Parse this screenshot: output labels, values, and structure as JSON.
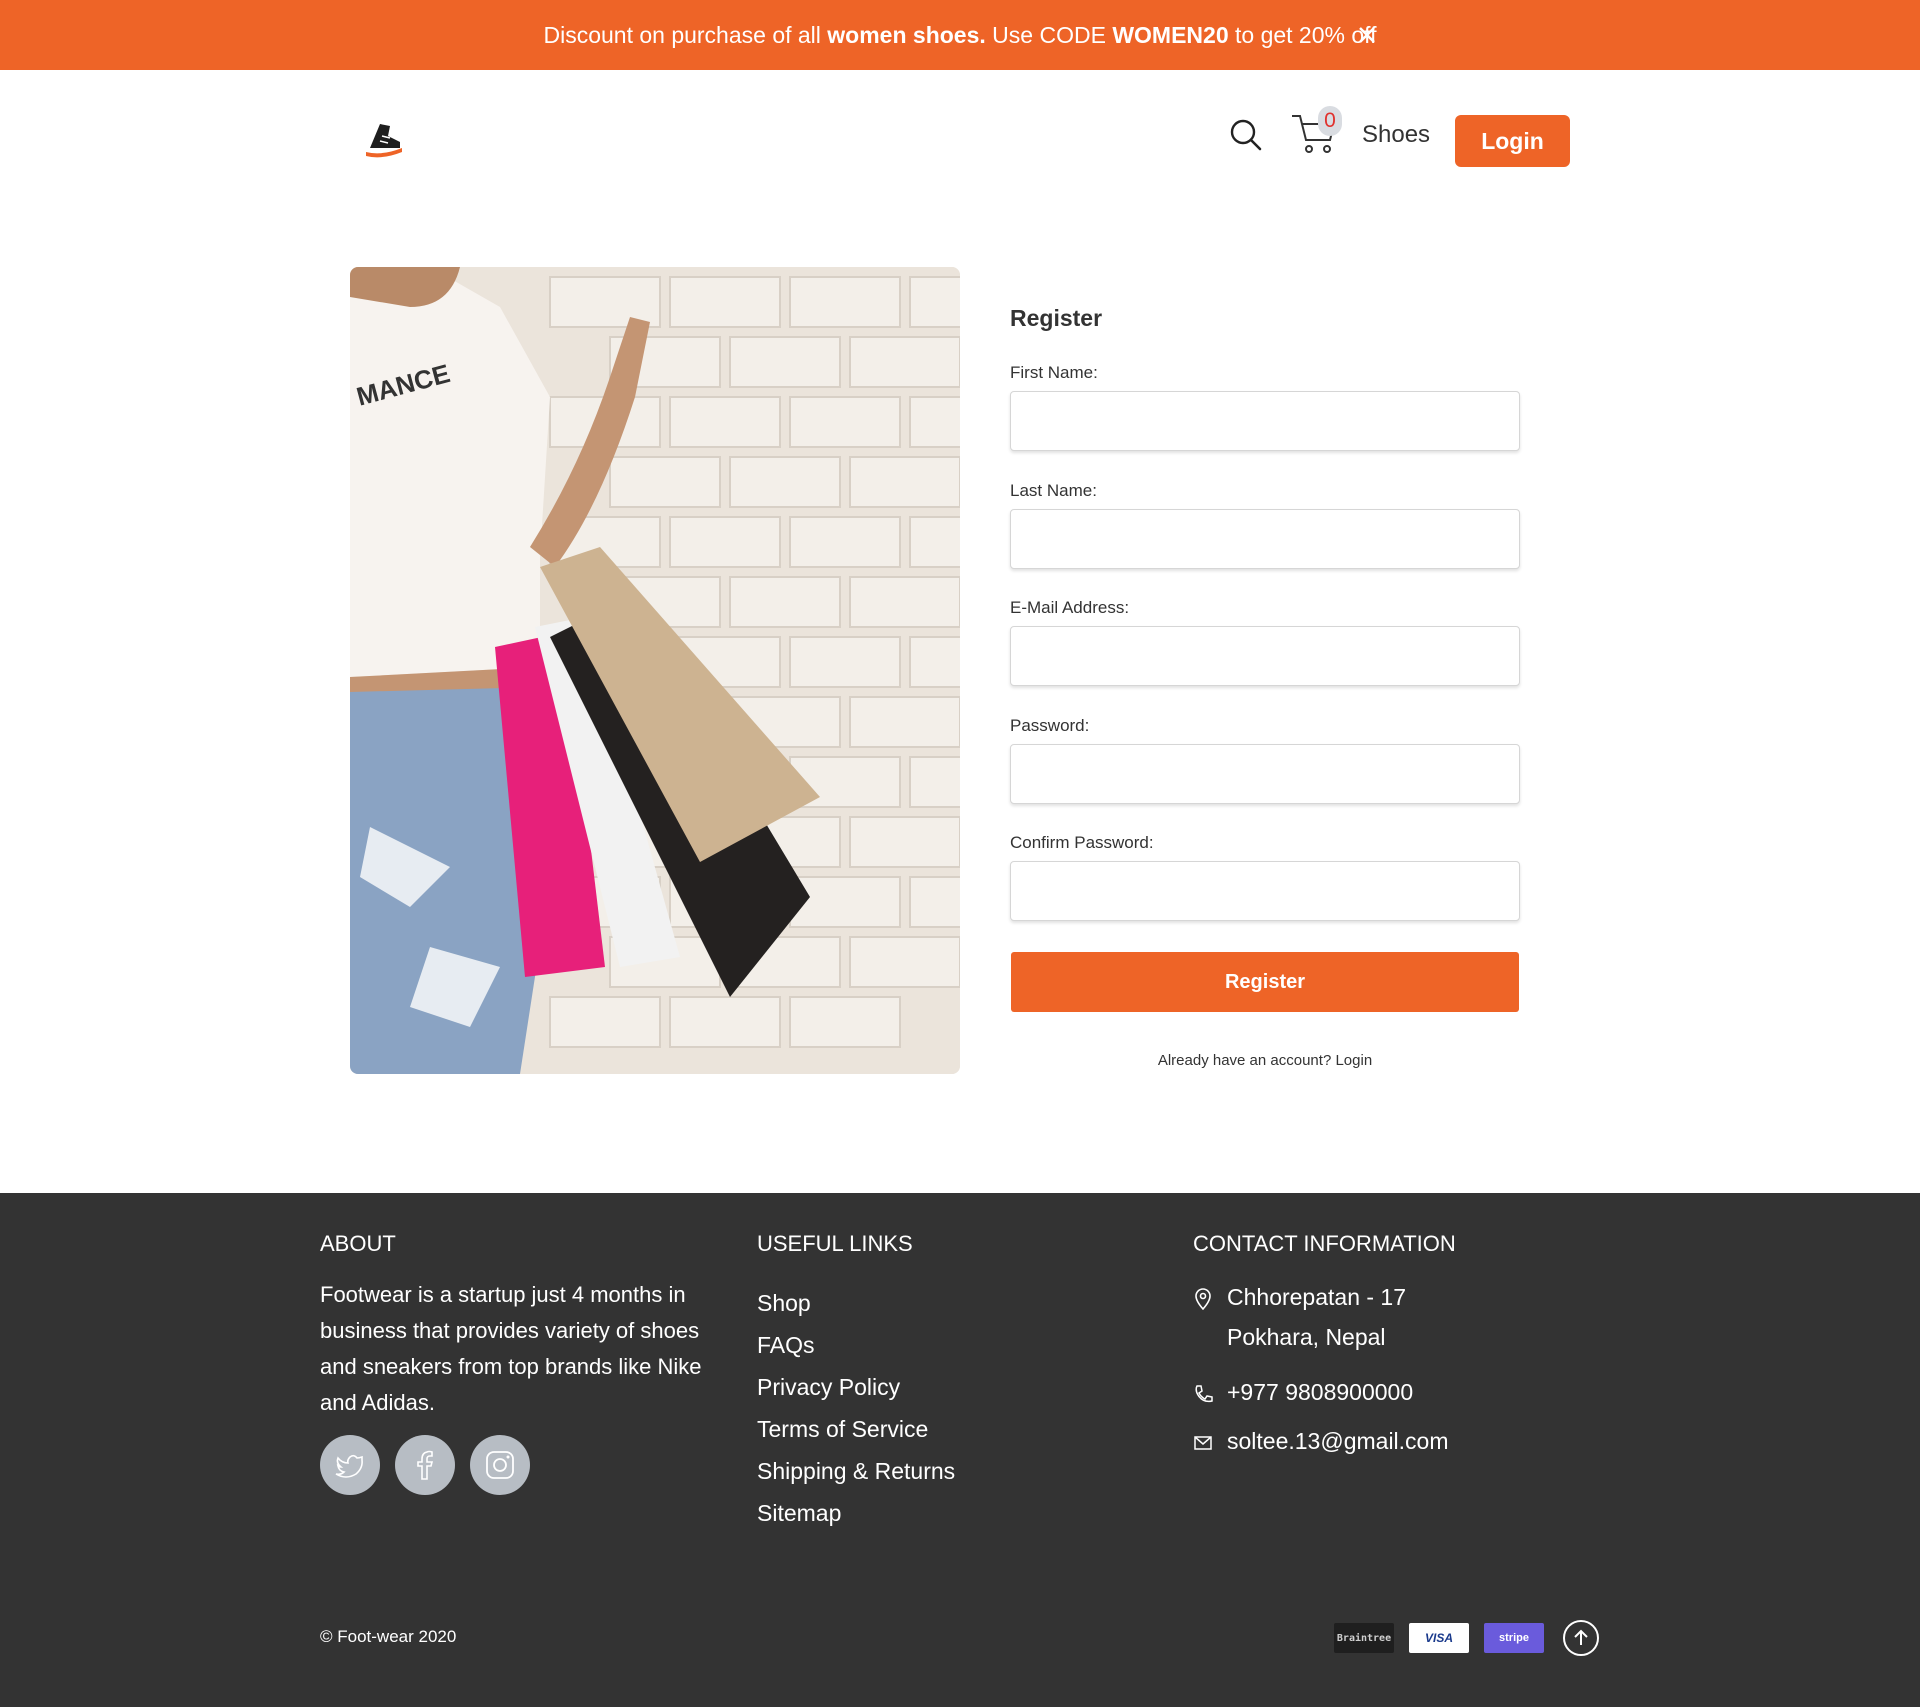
{
  "promo": {
    "text_1": "Discount on purchase of all ",
    "bold_1": "women shoes.",
    "text_2": " Use CODE ",
    "bold_2": "WOMEN20",
    "text_3": " to get 20% off",
    "close_icon": "close-icon"
  },
  "header": {
    "logo_icon": "sneaker-logo-icon",
    "search_icon": "search-icon",
    "cart_icon": "cart-icon",
    "cart_count": "0",
    "nav_shoes": "Shoes",
    "login_label": "Login"
  },
  "form": {
    "title": "Register",
    "fields": [
      {
        "label": "First Name:",
        "value": ""
      },
      {
        "label": "Last Name:",
        "value": ""
      },
      {
        "label": "E-Mail Address:",
        "value": ""
      },
      {
        "label": "Password:",
        "value": ""
      },
      {
        "label": "Confirm Password:",
        "value": ""
      }
    ],
    "submit_label": "Register",
    "have_account": "Already have an account?",
    "login_link": "Login"
  },
  "footer": {
    "about_heading": "ABOUT",
    "about_text": "Footwear is a startup just 4 months in business that provides variety of shoes and sneakers from top brands like Nike and Adidas.",
    "social": [
      "twitter-icon",
      "facebook-icon",
      "instagram-icon"
    ],
    "links_heading": "USEFUL LINKS",
    "links": [
      "Shop",
      "FAQs",
      "Privacy Policy",
      "Terms of Service",
      "Shipping & Returns",
      "Sitemap"
    ],
    "contact_heading": "CONTACT INFORMATION",
    "address_line1": "Chhorepatan - 17",
    "address_line2": "Pokhara, Nepal",
    "phone": "+977 9808900000",
    "email": "soltee.13@gmail.com",
    "copyright": "© Foot-wear 2020",
    "payments": [
      "Braintree",
      "VISA",
      "stripe"
    ],
    "brand_colors": {
      "accent": "#ee6427",
      "footer_bg": "#333333"
    }
  }
}
